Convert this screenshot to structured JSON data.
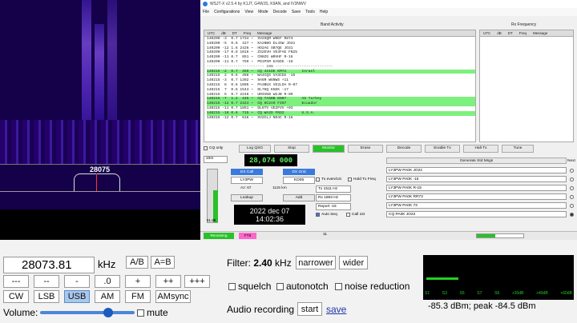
{
  "waterfall": {
    "freq_label": "28075"
  },
  "wsjt": {
    "title": "WSJT-X   v2.5.4   by K1JT, G4WJS, K9AN, and IV3NWV",
    "menu": [
      "File",
      "Configurations",
      "View",
      "Mode",
      "Decode",
      "Save",
      "Tools",
      "Help"
    ],
    "band_activity_label": "Band Activity",
    "rx_frequency_label": "Rx Frequency",
    "columns": [
      "UTC",
      "dB",
      "DT",
      "Freq",
      "Message"
    ],
    "rows": [
      {
        "t": "140200 -3  0.7 1734 ~  SV2SQM W9EF R873",
        "hl": false
      },
      {
        "t": "140200 -5  0.6  427 ~  KA2NBO DL4SW JO31",
        "hl": false
      },
      {
        "t": "140200 -12 1.6 2426 ~  HO2AG SB7QE JO31",
        "hl": false
      },
      {
        "t": "140200 -17 0.8 1016 ~  ZS2EVH VE3FAE FN25",
        "hl": false
      },
      {
        "t": "140200 -11 0.7  851 ~  CN8ZG W0VHF R-16",
        "hl": false
      },
      {
        "t": "140200 -11 0.7  759 ~  PD1PSR EA5DG -16",
        "hl": false
      },
      {
        "t": "-------------------------- 10m --------------------------",
        "hl": false
      },
      {
        "t": "140215 -2  0.7  359 ~  CQ 4X1DE KM72       Israel",
        "hl": true
      },
      {
        "t": "140215  2  0.6  466 ~  WA4CQS VA3CGG -15",
        "hl": false
      },
      {
        "t": "140215 -3  0.7 1392 ~  9A6R W6NWS +11",
        "hl": false
      },
      {
        "t": "140215  6  0.6 1005 ~  PA3BUX VE2LOA R-07",
        "hl": false
      },
      {
        "t": "140215  7  0.6 1543 ~  DL7KQ K5EK -17",
        "hl": false
      },
      {
        "t": "140215  5  0.7 2246 ~  UR3VKB W2JB R-09",
        "hl": false
      },
      {
        "t": "140215 -7  1.2  445 ~  CQ TA5BB KN07       AS Turkey",
        "hl": true
      },
      {
        "t": "140215 -12 0.7 2424 ~  CQ HC2AO FI07       Ecuador",
        "hl": true
      },
      {
        "t": "140215 -11 0.7 1851 ~  DL6TV VE2FVV +03",
        "hl": false
      },
      {
        "t": "140215 -16 0.6  715 ~  CQ WA2D FN32        U.S.A.",
        "hl": true
      },
      {
        "t": "140215 -12 0.7  616 ~  SV2CLJ NO4C R-16",
        "hl": false
      }
    ],
    "controls": [
      "CQ only",
      "Log QSO",
      "Stop",
      "Monitor",
      "Erase",
      "Decode",
      "Enable Tx",
      "Halt Tx",
      "Tune"
    ],
    "tx_even": "Tx even/1st",
    "hold_tx": "Hold Tx Freq",
    "band": "10m",
    "dial_freq": "28,074 000",
    "tx_hz": "Tx  1511 Hz",
    "rx_hz": "Rx  1893 Hz",
    "report": "Report -15",
    "dx_call_label": "DX Call",
    "dx_grid_label": "DX Grid",
    "dx_call": "LY3PW",
    "dx_grid": "KO05",
    "az": "Az: 67",
    "dist": "1115 km",
    "lookup": "Lookup",
    "add": "Add",
    "auto_seq": "Auto Seq",
    "call_1st": "Call 1st",
    "meter_db": "51 dB",
    "date": "2022 dec 07",
    "time": "14:02:36",
    "gen_msgs": "Generate Std Msgs",
    "next_label": "Next",
    "tx_msgs": [
      "LY3PW PA0K JO22",
      "LY3PW PA0K -15",
      "LY3PW PA0K R-15",
      "LY3PW PA0K RR73",
      "LY3PW PA0K 73",
      "CQ PA0K JO22"
    ],
    "status_receiving": "Receiving",
    "status_mode": "FT8",
    "status_num": "11",
    "progress": 0.4
  },
  "sdr": {
    "frequency": "28073.81",
    "unit": "kHz",
    "ab": "A/B",
    "aeqb": "A=B",
    "steps": [
      "---",
      "--",
      "-",
      ".0",
      "+",
      "++",
      "+++"
    ],
    "modes": [
      "CW",
      "LSB",
      "USB",
      "AM",
      "FM",
      "AMsync"
    ],
    "active_mode": "USB",
    "volume_label": "Volume:",
    "volume": 0.72,
    "mute": "mute",
    "filter_prefix": "Filter:",
    "filter_value": "2.40",
    "filter_unit": "kHz",
    "narrower": "narrower",
    "wider": "wider",
    "squelch": "squelch",
    "autonotch": "autonotch",
    "noise_reduction": "noise reduction",
    "audio_recording": "Audio recording",
    "start": "start",
    "save": "save",
    "smeter_scale": [
      "S1",
      "S3",
      "S5",
      "S7",
      "S9",
      "+20dB",
      "+40dB",
      "+60dB"
    ],
    "smeter_level": 0.22,
    "signal_reading": "-85.3 dBm; peak  -84.5 dBm",
    "colors": {
      "accent": "#3a7adc",
      "highlight_row": "#7ef07e",
      "dial_text": "#5ef05e"
    }
  }
}
